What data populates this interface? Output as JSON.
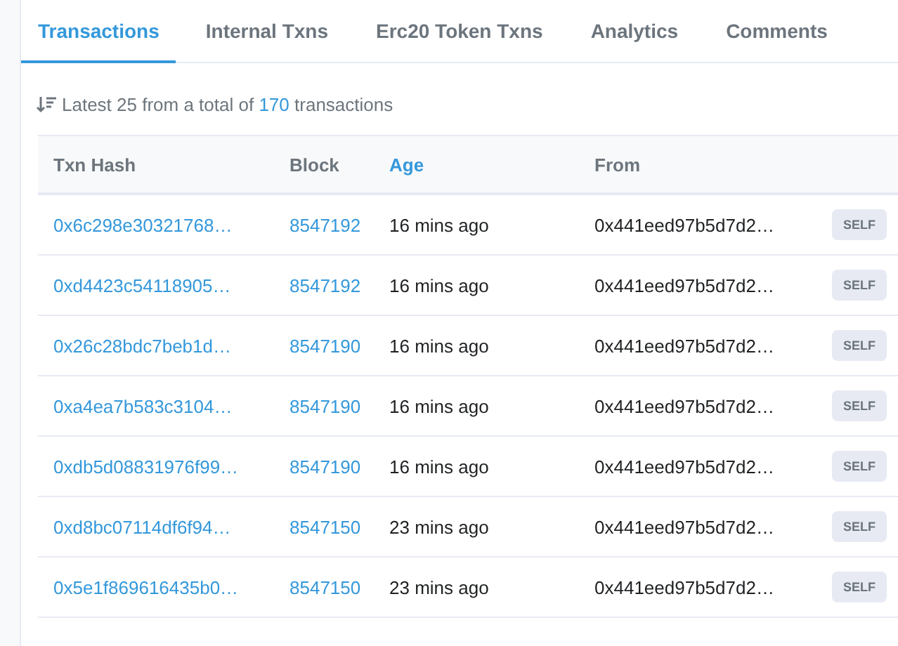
{
  "tabs": [
    {
      "label": "Transactions",
      "selected": true
    },
    {
      "label": "Internal Txns",
      "selected": false
    },
    {
      "label": "Erc20 Token Txns",
      "selected": false
    },
    {
      "label": "Analytics",
      "selected": false
    },
    {
      "label": "Comments",
      "selected": false
    }
  ],
  "summary": {
    "prefix": "Latest 25 from a total of",
    "count": "170",
    "suffix": "transactions"
  },
  "table": {
    "columns": [
      {
        "label": "Txn Hash",
        "selected": false
      },
      {
        "label": "Block",
        "selected": false
      },
      {
        "label": "Age",
        "selected": true
      },
      {
        "label": "From",
        "selected": false
      }
    ],
    "rows": [
      {
        "hash": "0x6c298e30321768…",
        "block": "8547192",
        "age": "16 mins ago",
        "from": "0x441eed97b5d7d2…",
        "badge": "SELF"
      },
      {
        "hash": "0xd4423c54118905…",
        "block": "8547192",
        "age": "16 mins ago",
        "from": "0x441eed97b5d7d2…",
        "badge": "SELF"
      },
      {
        "hash": "0x26c28bdc7beb1d…",
        "block": "8547190",
        "age": "16 mins ago",
        "from": "0x441eed97b5d7d2…",
        "badge": "SELF"
      },
      {
        "hash": "0xa4ea7b583c3104…",
        "block": "8547190",
        "age": "16 mins ago",
        "from": "0x441eed97b5d7d2…",
        "badge": "SELF"
      },
      {
        "hash": "0xdb5d08831976f99…",
        "block": "8547190",
        "age": "16 mins ago",
        "from": "0x441eed97b5d7d2…",
        "badge": "SELF"
      },
      {
        "hash": "0xd8bc07114df6f94…",
        "block": "8547150",
        "age": "23 mins ago",
        "from": "0x441eed97b5d7d2…",
        "badge": "SELF"
      },
      {
        "hash": "0x5e1f869616435b0…",
        "block": "8547150",
        "age": "23 mins ago",
        "from": "0x441eed97b5d7d2…",
        "badge": "SELF"
      }
    ]
  }
}
